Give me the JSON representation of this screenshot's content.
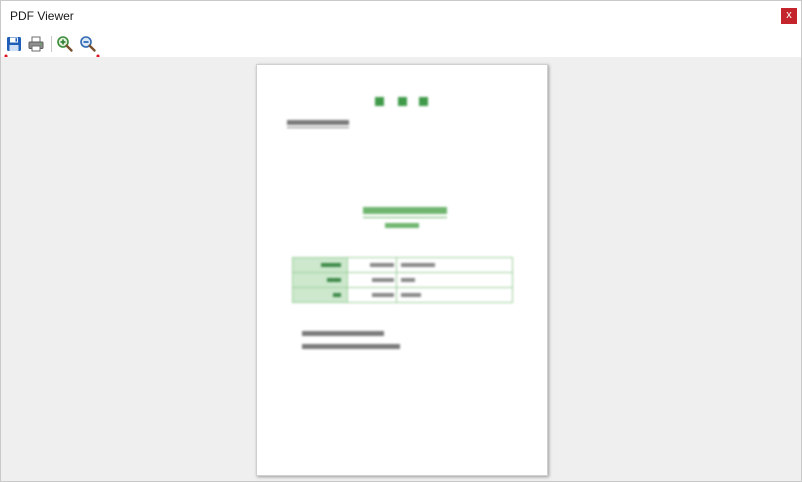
{
  "window": {
    "title": "PDF Viewer",
    "close_label": "x"
  },
  "toolbar": {
    "buttons": [
      {
        "name": "save",
        "icon": "floppy-disk-icon"
      },
      {
        "name": "print",
        "icon": "printer-icon"
      },
      {
        "name": "zoom-in",
        "icon": "zoom-in-icon"
      },
      {
        "name": "zoom-out",
        "icon": "zoom-out-icon"
      }
    ],
    "highlight_color": "#e0141e"
  },
  "colors": {
    "title_bar": "#ffffff",
    "viewer_background": "#efefef",
    "page": "#ffffff",
    "document_green": "#3f9a49",
    "table_header_green": "#cde8cd"
  },
  "document": {
    "content_note": "blurred document page"
  }
}
